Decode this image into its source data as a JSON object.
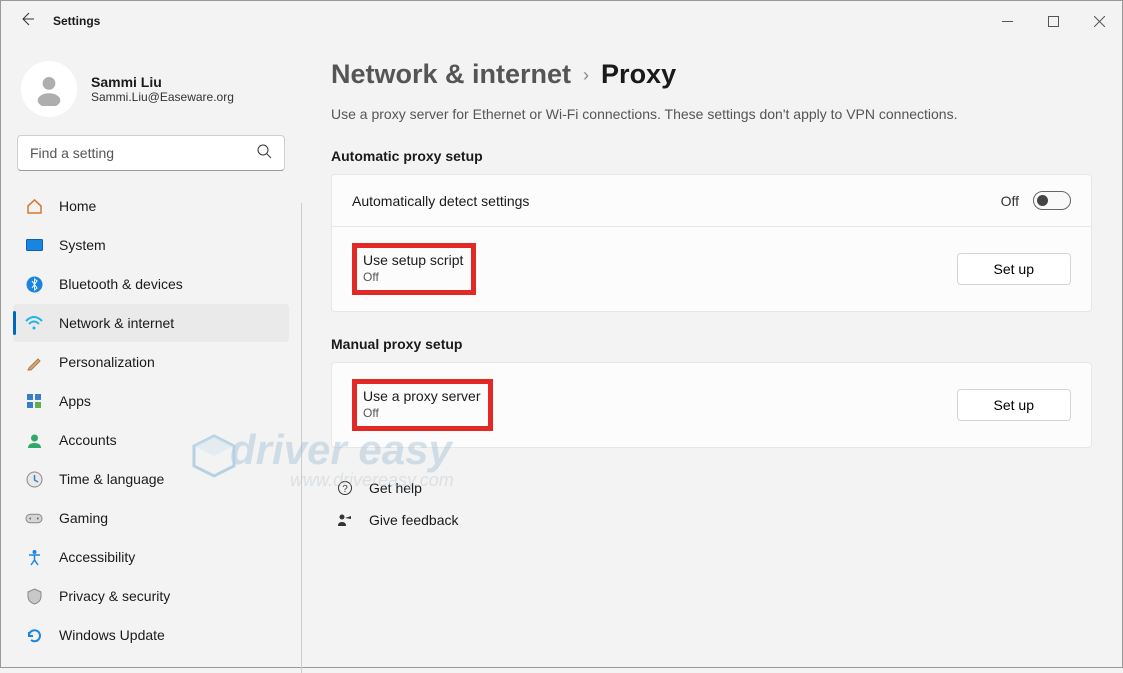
{
  "app_title": "Settings",
  "user": {
    "name": "Sammi Liu",
    "email": "Sammi.Liu@Easeware.org"
  },
  "search_placeholder": "Find a setting",
  "nav": [
    {
      "icon": "home",
      "label": "Home"
    },
    {
      "icon": "system",
      "label": "System"
    },
    {
      "icon": "bluetooth",
      "label": "Bluetooth & devices"
    },
    {
      "icon": "network",
      "label": "Network & internet",
      "selected": true
    },
    {
      "icon": "personalize",
      "label": "Personalization"
    },
    {
      "icon": "apps",
      "label": "Apps"
    },
    {
      "icon": "accounts",
      "label": "Accounts"
    },
    {
      "icon": "time",
      "label": "Time & language"
    },
    {
      "icon": "gaming",
      "label": "Gaming"
    },
    {
      "icon": "accessibility",
      "label": "Accessibility"
    },
    {
      "icon": "privacy",
      "label": "Privacy & security"
    },
    {
      "icon": "update",
      "label": "Windows Update"
    }
  ],
  "breadcrumb": {
    "parent": "Network & internet",
    "current": "Proxy"
  },
  "description": "Use a proxy server for Ethernet or Wi-Fi connections. These settings don't apply to VPN connections.",
  "auto_section": {
    "title": "Automatic proxy setup",
    "detect_label": "Automatically detect settings",
    "detect_state": "Off",
    "script_label": "Use setup script",
    "script_state": "Off",
    "setup_button": "Set up"
  },
  "manual_section": {
    "title": "Manual proxy setup",
    "proxy_label": "Use a proxy server",
    "proxy_state": "Off",
    "setup_button": "Set up"
  },
  "help": {
    "get_help": "Get help",
    "feedback": "Give feedback"
  },
  "watermark": {
    "line1": "driver easy",
    "line2": "www.drivereasy.com"
  }
}
